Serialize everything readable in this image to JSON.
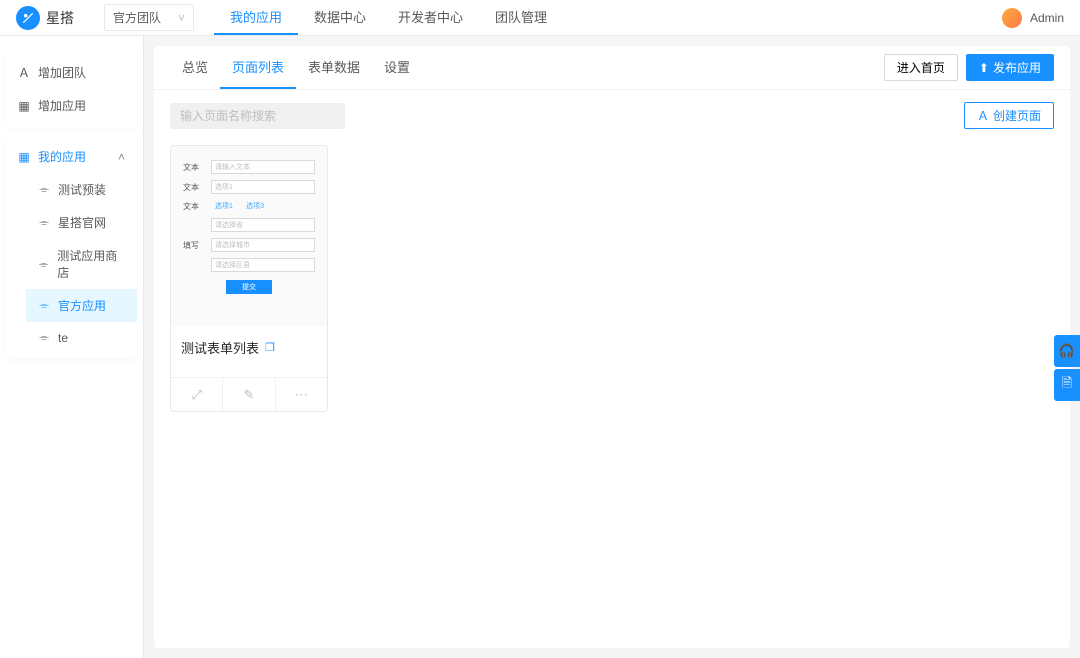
{
  "header": {
    "brand": "星搭",
    "team_selector": "官方团队",
    "nav": [
      "我的应用",
      "数据中心",
      "开发者中心",
      "团队管理"
    ],
    "nav_active_index": 0,
    "user_name": "Admin"
  },
  "sidebar": {
    "top": [
      {
        "icon": "user",
        "label": "增加团队"
      },
      {
        "icon": "grid",
        "label": "增加应用"
      }
    ],
    "group": {
      "icon": "apps",
      "label": "我的应用",
      "expanded": true,
      "items": [
        {
          "label": "测试预装"
        },
        {
          "label": "星搭官网"
        },
        {
          "label": "测试应用商店"
        },
        {
          "label": "官方应用",
          "active": true
        },
        {
          "label": "te"
        }
      ]
    }
  },
  "content": {
    "tabs": [
      "总览",
      "页面列表",
      "表单数据",
      "设置"
    ],
    "active_tab_index": 1,
    "enter_home": "进入首页",
    "publish": "发布应用",
    "search_placeholder": "输入页面名称搜索",
    "create_page": "创建页面"
  },
  "page_card": {
    "thumb": {
      "rows": [
        {
          "label": "文本",
          "value": "请输入文本"
        },
        {
          "label": "文本",
          "value": "选项1"
        },
        {
          "label": "文本",
          "tags": [
            "选项1",
            "选项3"
          ]
        },
        {
          "label": "",
          "value": "请选择省"
        },
        {
          "label": "填写",
          "value": "请选择城市"
        },
        {
          "label": "",
          "value": "请选择区县"
        }
      ],
      "submit": "提交"
    },
    "title": "测试表单列表"
  },
  "icons": {
    "upload": "⬆",
    "user": "Ａ",
    "grid": "▦",
    "chart": "⌯",
    "chevron_down": "˅",
    "chevron_up": "˄",
    "copy": "❐",
    "expand": "⤢",
    "edit": "✎",
    "more": "⋯",
    "headset": "🎧",
    "doc": "🗎"
  }
}
